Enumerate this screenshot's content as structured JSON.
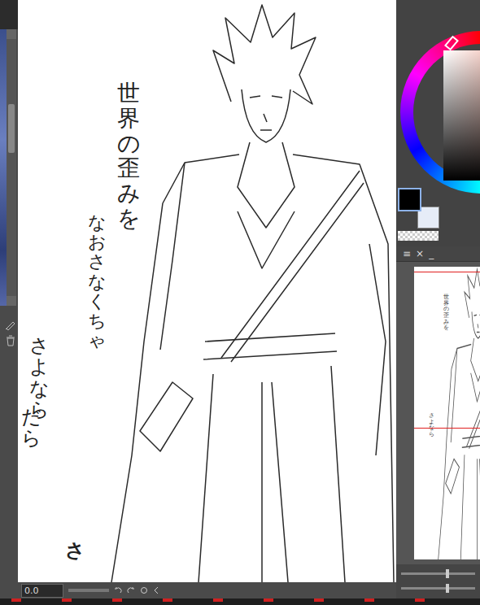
{
  "canvas": {
    "handwriting": [
      {
        "text": "世界の歪みを"
      },
      {
        "text": "なおさなくちゃ"
      },
      {
        "text": "さよなら"
      },
      {
        "text": "だら"
      },
      {
        "text": "さ"
      }
    ]
  },
  "status_bar": {
    "zoom_field": "0.0"
  },
  "color_panel": {
    "main_color": "#000000",
    "sub_color": "#e6ecf7",
    "main_selected": true
  },
  "navigator": {
    "menu_icon": "≡",
    "close_icon": "×",
    "minimize_icon": "_",
    "thumbnail_texts": [
      "世界の歪みを",
      "さよなら"
    ],
    "sliders": [
      {
        "level": 0.6
      },
      {
        "level": 0.6
      }
    ]
  }
}
